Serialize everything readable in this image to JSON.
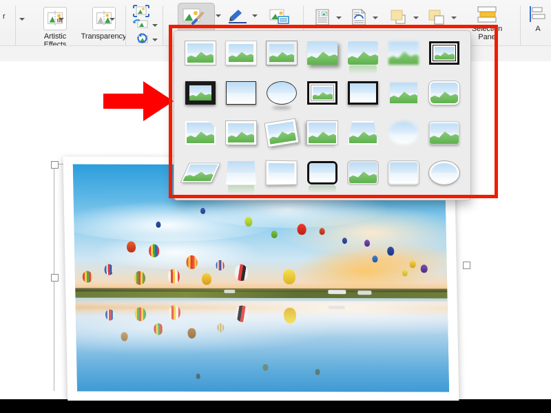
{
  "app": {
    "context": "PowerPoint Picture Format ribbon with Picture Styles gallery open"
  },
  "ribbon": {
    "groups": [
      {
        "name": "adjust",
        "buttons": [
          {
            "id": "color",
            "label": "r",
            "icon": "color-picture-icon",
            "has_dropdown": true
          },
          {
            "id": "artistic_effects",
            "label": "Artistic\nEffects",
            "label_line1": "Artistic",
            "label_line2": "Effects",
            "icon": "artistic-effects-icon",
            "has_dropdown": true
          },
          {
            "id": "transparency",
            "label": "Transparency",
            "icon": "transparency-icon",
            "has_dropdown": true
          }
        ]
      },
      {
        "name": "crop-reset",
        "buttons": [
          {
            "id": "crop_to_fit",
            "label": "",
            "icon": "crop-expand-icon",
            "has_dropdown": false
          },
          {
            "id": "change_picture",
            "label": "",
            "icon": "change-picture-icon",
            "has_dropdown": true
          },
          {
            "id": "reset_picture",
            "label": "",
            "icon": "reset-picture-icon",
            "has_dropdown": true
          }
        ]
      },
      {
        "name": "picture-styles",
        "buttons": [
          {
            "id": "picture_styles",
            "label": "",
            "icon": "picture-quick-styles-icon",
            "has_dropdown": true,
            "state": "pressed"
          },
          {
            "id": "picture_border",
            "label": "",
            "icon": "picture-border-pen-icon",
            "has_dropdown": true
          },
          {
            "id": "picture_effects",
            "label": "",
            "icon": "picture-effects-icon",
            "has_dropdown": true
          },
          {
            "id": "picture_layout",
            "label": "",
            "icon": "picture-layout-icon",
            "has_dropdown": false
          }
        ]
      },
      {
        "name": "arrange",
        "buttons": [
          {
            "id": "alt_text",
            "label": "",
            "icon": "alt-text-document-icon",
            "has_dropdown": true
          },
          {
            "id": "wrap_text",
            "label": "",
            "icon": "wrap-text-document-icon",
            "has_dropdown": true
          },
          {
            "id": "bring_forward",
            "label": "",
            "icon": "bring-forward-icon",
            "has_dropdown": true
          },
          {
            "id": "send_backward",
            "label": "",
            "icon": "send-backward-icon",
            "has_dropdown": true
          },
          {
            "id": "selection_pane",
            "label_line1": "Selection",
            "label_line2": "Pane",
            "icon": "selection-pane-icon",
            "has_dropdown": false
          },
          {
            "id": "align",
            "label_line1": "A",
            "icon": "align-icon",
            "has_dropdown": false
          }
        ]
      }
    ]
  },
  "gallery": {
    "name": "picture-styles-gallery",
    "columns": 7,
    "rows": 4,
    "items": [
      {
        "index": 0,
        "style": "simple-frame-white",
        "selected": false
      },
      {
        "index": 1,
        "style": "beveled-matte-white",
        "selected": false
      },
      {
        "index": 2,
        "style": "metal-frame",
        "selected": false
      },
      {
        "index": 3,
        "style": "drop-shadow-rectangle",
        "selected": false
      },
      {
        "index": 4,
        "style": "reflected-rounded-rectangle",
        "selected": false
      },
      {
        "index": 5,
        "style": "soft-edge-rectangle",
        "selected": false
      },
      {
        "index": 6,
        "style": "double-frame-black",
        "selected": true
      },
      {
        "index": 7,
        "style": "thick-matte-black",
        "selected": true
      },
      {
        "index": 8,
        "style": "simple-frame-black",
        "selected": false
      },
      {
        "index": 9,
        "style": "rotated-white",
        "selected": false
      },
      {
        "index": 10,
        "style": "center-shadow-rectangle",
        "selected": true
      },
      {
        "index": 11,
        "style": "compound-frame-black",
        "selected": true
      },
      {
        "index": 12,
        "style": "moderate-frame-black",
        "selected": false
      },
      {
        "index": 13,
        "style": "rounded-diagonal-corner-white",
        "selected": false
      },
      {
        "index": 14,
        "style": "snip-diagonal-corner-white",
        "selected": false
      },
      {
        "index": 15,
        "style": "moderate-frame-white",
        "selected": false
      },
      {
        "index": 16,
        "style": "rotated-white-tilt",
        "selected": false
      },
      {
        "index": 17,
        "style": "perspective-shadow-white",
        "selected": false
      },
      {
        "index": 18,
        "style": "relaxed-perspective-white",
        "selected": false
      },
      {
        "index": 19,
        "style": "soft-edge-oval",
        "selected": false
      },
      {
        "index": 20,
        "style": "bevel-rectangle",
        "selected": false
      },
      {
        "index": 21,
        "style": "bevel-perspective-left",
        "selected": false
      },
      {
        "index": 22,
        "style": "reflected-perspective-right",
        "selected": false
      },
      {
        "index": 23,
        "style": "reflected-bevel-white",
        "selected": false
      },
      {
        "index": 24,
        "style": "metal-rounded-rectangle",
        "selected": false
      },
      {
        "index": 25,
        "style": "reflected-bevel-black",
        "selected": true
      },
      {
        "index": 26,
        "style": "bevel-perspective",
        "selected": false
      },
      {
        "index": 27,
        "style": "metal-oval",
        "selected": false
      }
    ]
  },
  "slide": {
    "picture": {
      "name": "hot-air-balloons-photo",
      "description": "Hot air balloon festival at sunset reflected in water",
      "frame": "white matte frame with drop shadow",
      "selected": true,
      "handles": 8
    }
  },
  "annotation": {
    "arrow": {
      "name": "red-arrow-annotation",
      "direction": "right",
      "color": "#ff0000"
    },
    "rectangle": {
      "name": "red-highlight-rectangle",
      "color": "#f01c00",
      "border_width": 5
    }
  },
  "colors": {
    "red_accent": "#f01c00",
    "ribbon_bg": "#f2f2f2",
    "gallery_bg": "#ececec",
    "canvas_bg": "#ffffff"
  }
}
